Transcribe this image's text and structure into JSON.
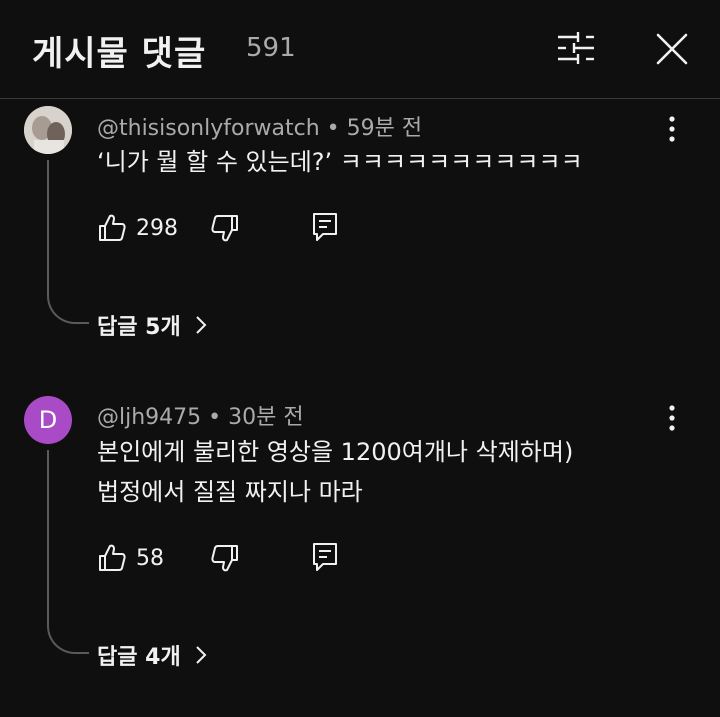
{
  "header": {
    "title": "게시물 댓글",
    "count": "591",
    "filter_icon": "filter-sliders-icon",
    "close_icon": "close-icon"
  },
  "comments": [
    {
      "avatar_type": "photo",
      "avatar_letter": "",
      "author": "@thisisonlyforwatch",
      "time": "59분 전",
      "text_lines": [
        "‘니가 뭘 할 수 있는데?’ ㅋㅋㅋㅋㅋㅋㅋㅋㅋㅋㅋ"
      ],
      "likes": "298",
      "replies_label": "답글 5개"
    },
    {
      "avatar_type": "letter",
      "avatar_letter": "D",
      "avatar_color": "#a94bc6",
      "author": "@ljh9475",
      "time": "30분 전",
      "text_lines": [
        "본인에게 불리한 영상을 1200여개나 삭제하며)",
        "법정에서 질질 짜지나 마라"
      ],
      "likes": "58",
      "replies_label": "답글 4개"
    }
  ]
}
